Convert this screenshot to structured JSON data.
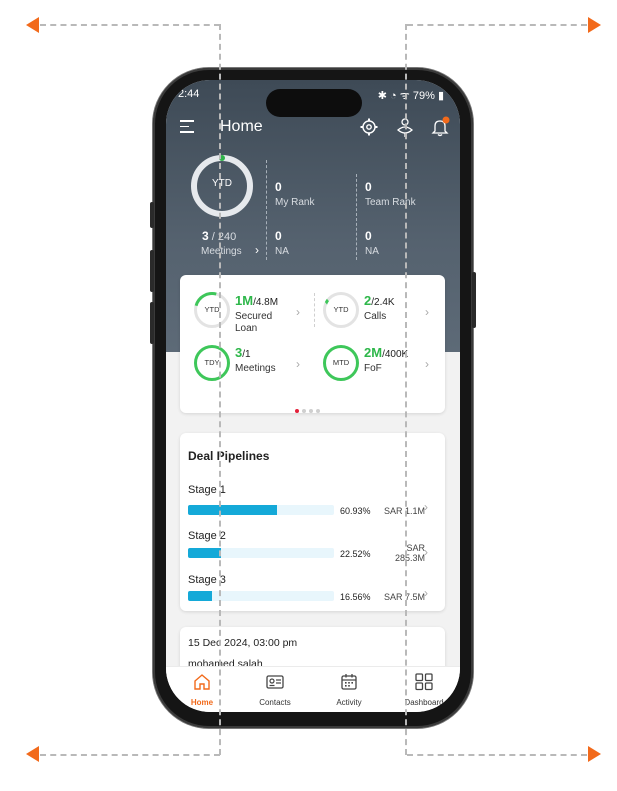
{
  "status": {
    "time": "2:44",
    "battery": "79%"
  },
  "header": {
    "title": "Home",
    "icons": [
      "menu-icon",
      "gear-icon",
      "leaderboard-icon",
      "bell-icon"
    ],
    "notification_color": "#f26a1b"
  },
  "summary": {
    "ring_label": "YTD",
    "meetings_done": "3",
    "meetings_total": "240",
    "meetings_label": "Meetings",
    "my_rank_value": "0",
    "my_rank_label": "My Rank",
    "team_rank_value": "0",
    "team_rank_label": "Team Rank",
    "na1_value": "0",
    "na1_label": "NA",
    "na2_value": "0",
    "na2_label": "NA"
  },
  "kpis": [
    {
      "period": "YTD",
      "value": "1M",
      "target": "4.8M",
      "label1": "Secured",
      "label2": "Loan"
    },
    {
      "period": "YTD",
      "value": "2",
      "target": "2.4K",
      "label1": "Calls",
      "label2": ""
    },
    {
      "period": "TDY",
      "value": "3",
      "target": "1",
      "label1": "Meetings",
      "label2": ""
    },
    {
      "period": "MTD",
      "value": "2M",
      "target": "400K",
      "label1": "FoF",
      "label2": ""
    }
  ],
  "pipelines": {
    "title": "Deal Pipelines",
    "stages": [
      {
        "name": "Stage 1",
        "percent_text": "60.93%",
        "percent": 60.93,
        "amount_line1": "SAR 1.1M",
        "amount_line2": ""
      },
      {
        "name": "Stage 2",
        "percent_text": "22.52%",
        "percent": 22.52,
        "amount_line1": "SAR",
        "amount_line2": "285.3M"
      },
      {
        "name": "Stage 3",
        "percent_text": "16.56%",
        "percent": 16.56,
        "amount_line1": "SAR 7.5M",
        "amount_line2": ""
      }
    ]
  },
  "activity": {
    "date": "15 Dec 2024, 03:00 pm",
    "name": "mohamed salah"
  },
  "nav": [
    {
      "label": "Home",
      "icon": "home-icon",
      "active": true
    },
    {
      "label": "Contacts",
      "icon": "contact-card-icon",
      "active": false
    },
    {
      "label": "Activity",
      "icon": "calendar-icon",
      "active": false
    },
    {
      "label": "Dashboard",
      "icon": "grid-icon",
      "active": false
    }
  ],
  "colors": {
    "accent": "#f26a1b",
    "green": "#2eb74a",
    "bar": "#14a9d8",
    "header": "#4a5662"
  }
}
